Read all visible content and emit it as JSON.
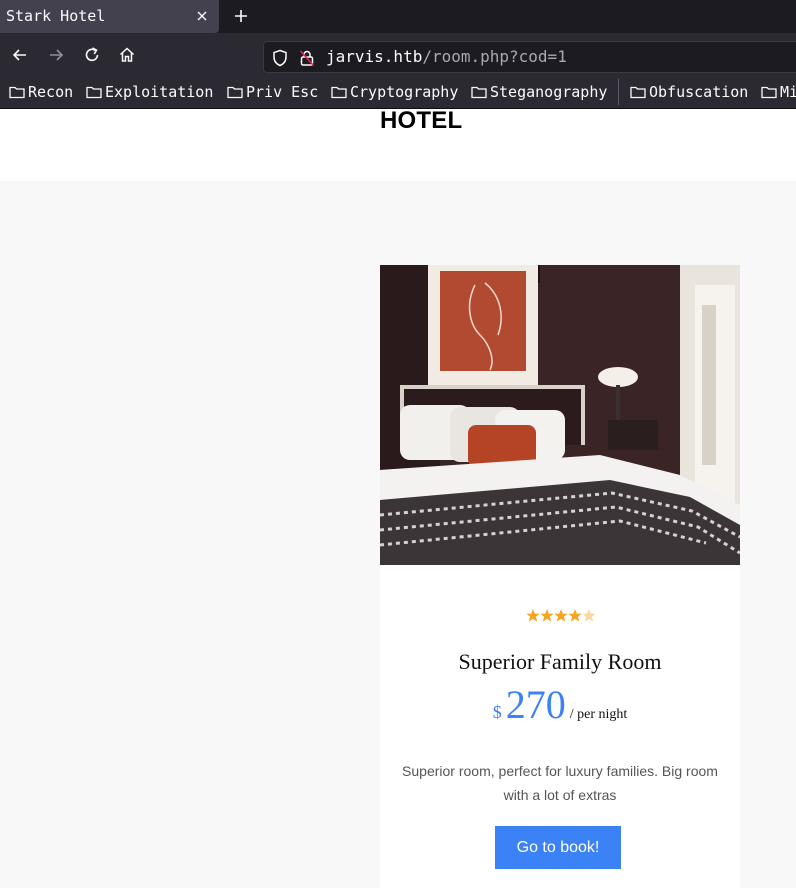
{
  "browser": {
    "tab_title": "Stark Hotel",
    "url_host": "jarvis.htb",
    "url_path": "/room.php?cod=1",
    "bookmarks": [
      "Recon",
      "Exploitation",
      "Priv Esc",
      "Cryptography",
      "Steganography",
      "Obfuscation",
      "Mi"
    ]
  },
  "page": {
    "brand": "HOTEL",
    "room": {
      "rating": 4.5,
      "rating_max": 5,
      "title": "Superior Family Room",
      "currency": "$",
      "price": "270",
      "price_unit": "/ per night",
      "description": "Superior room, perfect for luxury families. Big room with a lot of extras",
      "book_label": "Go to book!"
    }
  },
  "colors": {
    "accent": "#3b82f6",
    "star": "#f5a623",
    "chrome_dark": "#1c1b22",
    "chrome_mid": "#2b2a33"
  }
}
